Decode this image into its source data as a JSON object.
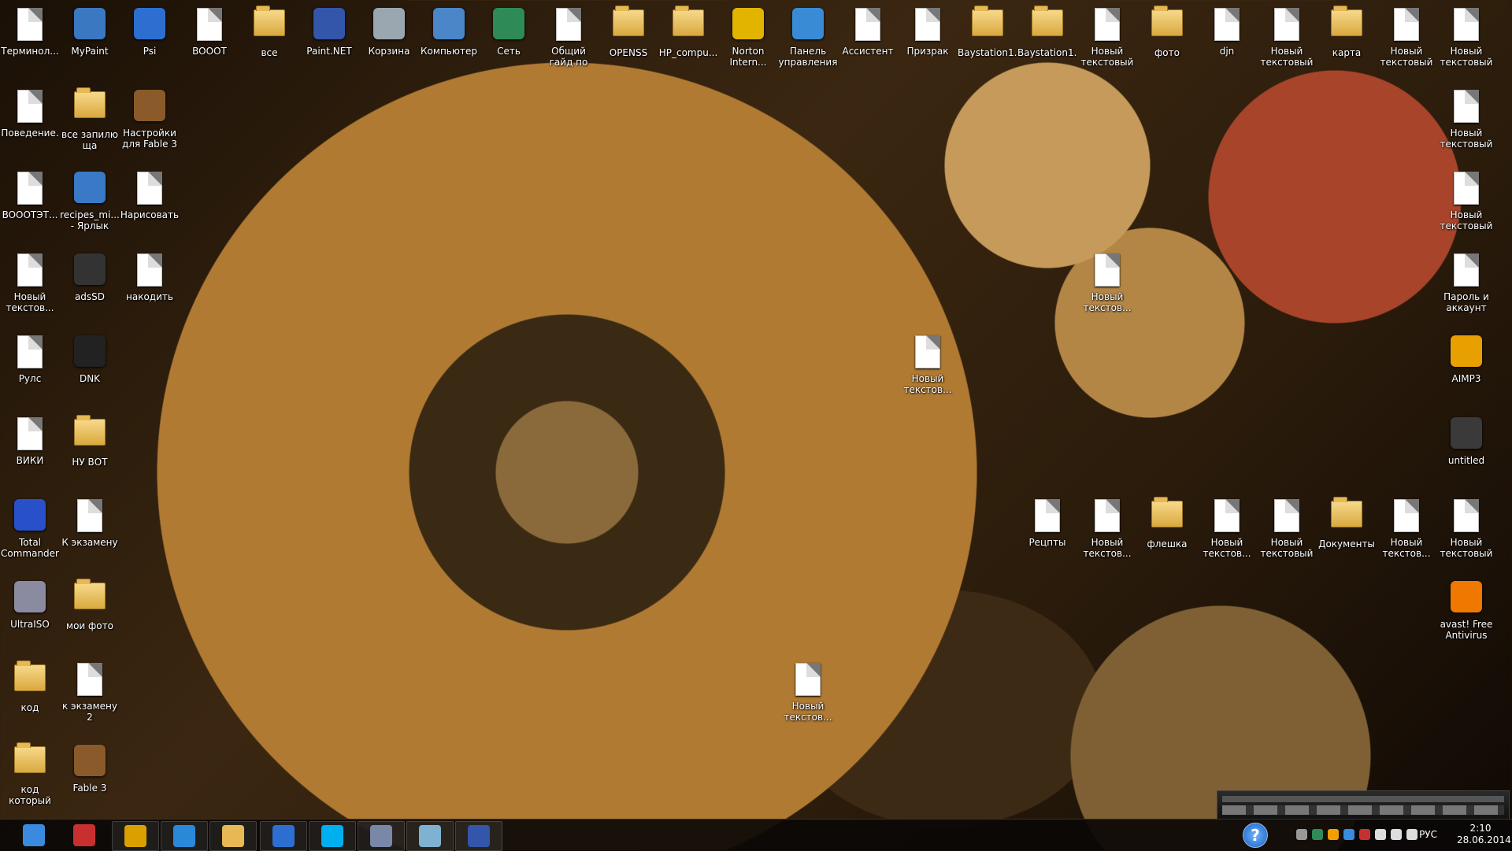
{
  "desktop_icons": [
    {
      "label": "Терминол...",
      "type": "doc"
    },
    {
      "label": "MyPaint",
      "type": "app",
      "color": "#3b78c2"
    },
    {
      "label": "Psi",
      "type": "app",
      "color": "#2d6fd0"
    },
    {
      "label": "BOOOT",
      "type": "doc"
    },
    {
      "label": "все",
      "type": "folder"
    },
    {
      "label": "Paint.NET",
      "type": "app",
      "color": "#3355aa"
    },
    {
      "label": "Корзина",
      "type": "app",
      "color": "#9aa6b0"
    },
    {
      "label": "Компьютер",
      "type": "app",
      "color": "#4a86c8"
    },
    {
      "label": "Сеть",
      "type": "app",
      "color": "#2e8b57"
    },
    {
      "label": "Общий гайд по гражда...",
      "type": "doc"
    },
    {
      "label": "OPENSS",
      "type": "folder"
    },
    {
      "label": "HP_compu...",
      "type": "folder"
    },
    {
      "label": "Norton Intern...",
      "type": "app",
      "color": "#e2b400"
    },
    {
      "label": "Панель управления",
      "type": "app",
      "color": "#3a8bd6"
    },
    {
      "label": "Ассистент",
      "type": "doc"
    },
    {
      "label": "Призрак",
      "type": "doc"
    },
    {
      "label": "Baystation1...",
      "type": "folder"
    },
    {
      "label": "Baystation1...",
      "type": "folder"
    },
    {
      "label": "Новый текстовый ...",
      "type": "doc"
    },
    {
      "label": "фото",
      "type": "folder"
    },
    {
      "label": "djn",
      "type": "doc"
    },
    {
      "label": "Новый текстовый ...",
      "type": "doc"
    },
    {
      "label": "карта",
      "type": "folder"
    },
    {
      "label": "Новый текстовый ...",
      "type": "doc"
    },
    {
      "label": "Новый текстовый ...",
      "type": "doc"
    },
    {
      "label": "Поведение.",
      "type": "doc"
    },
    {
      "label": "все запилю ща",
      "type": "folder"
    },
    {
      "label": "Настройки для Fable 3",
      "type": "app",
      "color": "#8a5a2a"
    },
    {
      "label": "Новый текстовый ...",
      "type": "doc"
    },
    {
      "label": "BOOOTЭТ...",
      "type": "doc"
    },
    {
      "label": "recipes_mi... - Ярлык",
      "type": "app",
      "color": "#3a79c6"
    },
    {
      "label": "Нарисовать",
      "type": "doc"
    },
    {
      "label": "Новый текстовый ...",
      "type": "doc"
    },
    {
      "label": "Новый текстов...",
      "type": "doc"
    },
    {
      "label": "adsSD",
      "type": "app",
      "color": "#333333"
    },
    {
      "label": "накодить",
      "type": "doc"
    },
    {
      "label": "Новый текстов...",
      "type": "doc"
    },
    {
      "label": "Пароль и аккаунт",
      "type": "doc"
    },
    {
      "label": "Рулс",
      "type": "doc"
    },
    {
      "label": "DNK",
      "type": "app",
      "color": "#222222"
    },
    {
      "label": "Новый текстов...",
      "type": "doc"
    },
    {
      "label": "AIMP3",
      "type": "app",
      "color": "#e8a000"
    },
    {
      "label": "ВИКИ",
      "type": "doc"
    },
    {
      "label": "НУ ВОТ",
      "type": "folder"
    },
    {
      "label": "untitled",
      "type": "app",
      "color": "#3a3a3a"
    },
    {
      "label": "Total Commander",
      "type": "app",
      "color": "#2850c8"
    },
    {
      "label": "К экзамену",
      "type": "doc"
    },
    {
      "label": "Рецпты",
      "type": "doc"
    },
    {
      "label": "Новый текстов...",
      "type": "doc"
    },
    {
      "label": "флешка",
      "type": "folder"
    },
    {
      "label": "Новый текстов...",
      "type": "doc"
    },
    {
      "label": "Новый текстовый ...",
      "type": "doc"
    },
    {
      "label": "Документы",
      "type": "folder"
    },
    {
      "label": "Новый текстов...",
      "type": "doc"
    },
    {
      "label": "Новый текстовый ...",
      "type": "doc"
    },
    {
      "label": "UltraISO",
      "type": "app",
      "color": "#8a8aa0"
    },
    {
      "label": "мои фото",
      "type": "folder"
    },
    {
      "label": "avast! Free Antivirus",
      "type": "app",
      "color": "#f07800"
    },
    {
      "label": "код",
      "type": "folder"
    },
    {
      "label": "к экзамену 2",
      "type": "doc"
    },
    {
      "label": "Новый текстов...",
      "type": "doc"
    },
    {
      "label": "код который нужно укр...",
      "type": "folder"
    },
    {
      "label": "Fable 3",
      "type": "app",
      "color": "#8a5a2a"
    }
  ],
  "taskbar": {
    "items": [
      {
        "name": "start-rocket",
        "color": "#3a8ae0"
      },
      {
        "name": "color-app",
        "color": "#c83030"
      },
      {
        "name": "chrome",
        "color": "#d9a000"
      },
      {
        "name": "internet-explorer",
        "color": "#2a88d8"
      },
      {
        "name": "explorer",
        "color": "#e6b955"
      },
      {
        "name": "psi",
        "color": "#2d6fd0"
      },
      {
        "name": "skype",
        "color": "#00aff0"
      },
      {
        "name": "recycle",
        "color": "#7a88a8"
      },
      {
        "name": "notes",
        "color": "#7fb2d0"
      },
      {
        "name": "paint-net",
        "color": "#3355aa"
      }
    ],
    "help_label": "?",
    "language": "РУС",
    "time": "2:10",
    "date": "28.06.2014"
  }
}
